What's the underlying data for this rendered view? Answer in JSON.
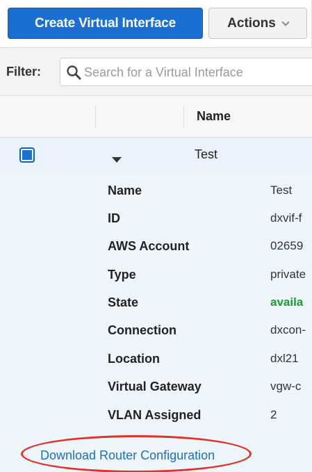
{
  "toolbar": {
    "create_label": "Create Virtual Interface",
    "actions_label": "Actions"
  },
  "filter": {
    "label": "Filter:",
    "placeholder": "Search for a Virtual Interface"
  },
  "table": {
    "columns": [
      "Name"
    ]
  },
  "selected_row": {
    "name": "Test"
  },
  "details": [
    {
      "label": "Name",
      "value": "Test"
    },
    {
      "label": "ID",
      "value": "dxvif-f"
    },
    {
      "label": "AWS Account",
      "value": "02659"
    },
    {
      "label": "Type",
      "value": "private"
    },
    {
      "label": "State",
      "value": "availa"
    },
    {
      "label": "Connection",
      "value": "dxcon-"
    },
    {
      "label": "Location",
      "value": "dxl21"
    },
    {
      "label": "Virtual Gateway",
      "value": "vgw-c"
    },
    {
      "label": "VLAN Assigned",
      "value": "2"
    }
  ],
  "download_link": "Download Router Configuration",
  "colors": {
    "primary": "#1a6fd1",
    "state_available": "#1b9e2e",
    "highlight": "#e0342b",
    "link": "#1a6fc4"
  }
}
